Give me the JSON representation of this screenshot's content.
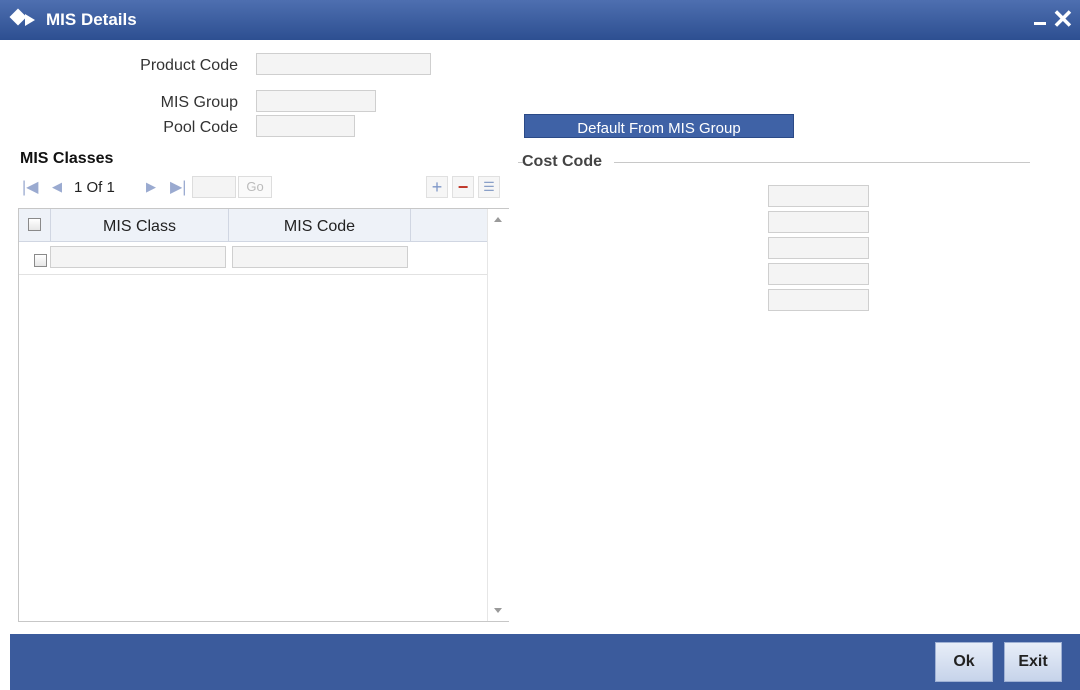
{
  "window": {
    "title": "MIS Details"
  },
  "fields": {
    "product_code_label": "Product Code",
    "product_code_value": "",
    "mis_group_label": "MIS Group",
    "mis_group_value": "",
    "pool_code_label": "Pool Code",
    "pool_code_value": ""
  },
  "default_button_label": "Default From MIS Group",
  "mis_classes": {
    "title": "MIS Classes",
    "pager_text": "1 Of 1",
    "go_label": "Go",
    "columns": [
      "MIS Class",
      "MIS Code"
    ],
    "rows": [
      {
        "mis_class": "",
        "mis_code": ""
      }
    ]
  },
  "cost_code": {
    "legend": "Cost Code",
    "values": [
      "",
      "",
      "",
      "",
      ""
    ]
  },
  "footer": {
    "ok_label": "Ok",
    "exit_label": "Exit"
  },
  "colors": {
    "titlebar": "#2d4f91",
    "footer": "#3b5b9c",
    "button_accent": "#3f62a6"
  },
  "icons": [
    "diamond-icon",
    "minimize-icon",
    "close-icon",
    "first-page-icon",
    "prev-page-icon",
    "next-page-icon",
    "last-page-icon",
    "add-row-icon",
    "delete-row-icon",
    "single-view-icon"
  ]
}
